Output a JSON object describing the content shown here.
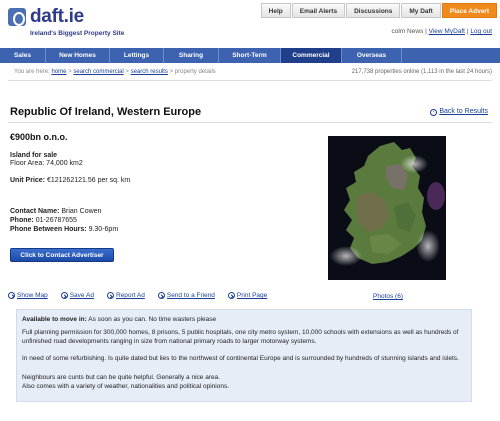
{
  "brand": {
    "name": "daft.ie",
    "tagline": "Ireland's Biggest Property Site"
  },
  "toplinks": [
    "Help",
    "Email Alerts",
    "Discussions",
    "My Daft",
    "Place Advert"
  ],
  "user": {
    "name": "colm News",
    "sep1": " | ",
    "view": "View MyDaft",
    "sep2": " | ",
    "logout": "Log out"
  },
  "nav": [
    "Sales",
    "New Homes",
    "Lettings",
    "Sharing",
    "Short-Term",
    "Commercial",
    "Overseas"
  ],
  "breadcrumb": {
    "prefix": "You are here:",
    "home": "home",
    "sep1": ">",
    "commercial": "search commercial",
    "sep2": ">",
    "results": "search results",
    "sep3": "> property details"
  },
  "properties_online": "217,738 properties online (1,113 in the last 24 hours)",
  "listing": {
    "title": "Republic Of Ireland, Western Europe",
    "back": "Back to Results",
    "price": "€900bn o.n.o.",
    "status": "Island for sale",
    "floor_area": "Floor Area: 74,000 km2",
    "unit_price_label": "Unit Price:",
    "unit_price": "€121262121.56 per sq. km",
    "contact_name_label": "Contact Name:",
    "contact_name": "Brian Cowen",
    "phone_label": "Phone:",
    "phone": "01-26787655",
    "hours_label": "Phone Between Hours:",
    "hours": "9.30-6pm",
    "contact_button": "Click to Contact Advertiser",
    "photos": "Photos (6)"
  },
  "actions": [
    "Show Map",
    "Save Ad",
    "Report Ad",
    "Send to a Friend",
    "Print Page"
  ],
  "description": {
    "available_label": "Available to move in:",
    "available": "As soon as you can. No time wasters please",
    "p1": "Full planning permission for 300,000 homes, 8 prisons, 5 public hospitals, one city metro system, 10,000 schools with extensions as well as hundreds of unfinished road developments ranging in size from national primary roads to larger motorway systems.",
    "p2": "In need of some refurbishing. Is quite dated but lies to the northwest of continental Europe and is surrounded by hundreds of stunning islands and islets.",
    "p3": "Neighbours are cunts but can be quite helpful. Generally a nice area.",
    "p4": "Also comes with a variety of weather, nationalities and political opinions."
  },
  "colors": {
    "brand": "#2f3a8a",
    "nav": "#3d62b0",
    "nav_active": "#1f3f8a",
    "accent": "#f08a1d",
    "link": "#1a3f96",
    "desc_bg": "#e6edf7"
  }
}
